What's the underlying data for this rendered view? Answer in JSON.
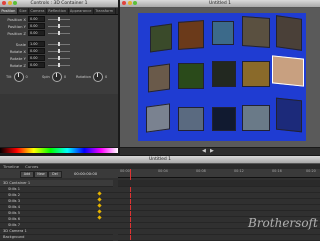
{
  "left_window": {
    "title": "Controls : 3D Container 1",
    "tabs": [
      "Position",
      "Size",
      "Camera",
      "Reflection",
      "Appearance",
      "Transform"
    ],
    "active_tab": "Position",
    "params": [
      {
        "label": "Position X",
        "value": "0.00"
      },
      {
        "label": "Position Y",
        "value": "0.00"
      },
      {
        "label": "Position Z",
        "value": "0.00"
      },
      {
        "label": "Scale",
        "value": "1.00"
      },
      {
        "label": "Rotate X",
        "value": "0.00"
      },
      {
        "label": "Rotate Y",
        "value": "0.00"
      },
      {
        "label": "Rotate Z",
        "value": "0.00"
      }
    ],
    "dials": [
      {
        "label": "Tilt",
        "value": "0"
      },
      {
        "label": "Spin",
        "value": "0"
      },
      {
        "label": "Rotation",
        "value": "0"
      }
    ]
  },
  "viewer_window": {
    "title": "Untitled 1"
  },
  "timeline_window": {
    "title": "Untitled 1",
    "tabs": [
      "Timeline",
      "Curves"
    ],
    "time": "00:00:00:00",
    "ruler": [
      "00:00",
      "00:04",
      "00:08",
      "00:12",
      "00:16",
      "00:20"
    ],
    "layers": [
      "3D Container 1",
      "Stills 1",
      "Stills 2",
      "Stills 3",
      "Stills 4",
      "Stills 5",
      "Stills 6",
      "Stills 7",
      "3D Camera 1",
      "Background"
    ],
    "buttons": [
      "Add",
      "New",
      "Del"
    ]
  },
  "watermark": "Brothersoft",
  "colors": {
    "canvas_blue": "#1f3cd2",
    "keyframe": "#e6b400",
    "panel": "#3c3c3c"
  }
}
